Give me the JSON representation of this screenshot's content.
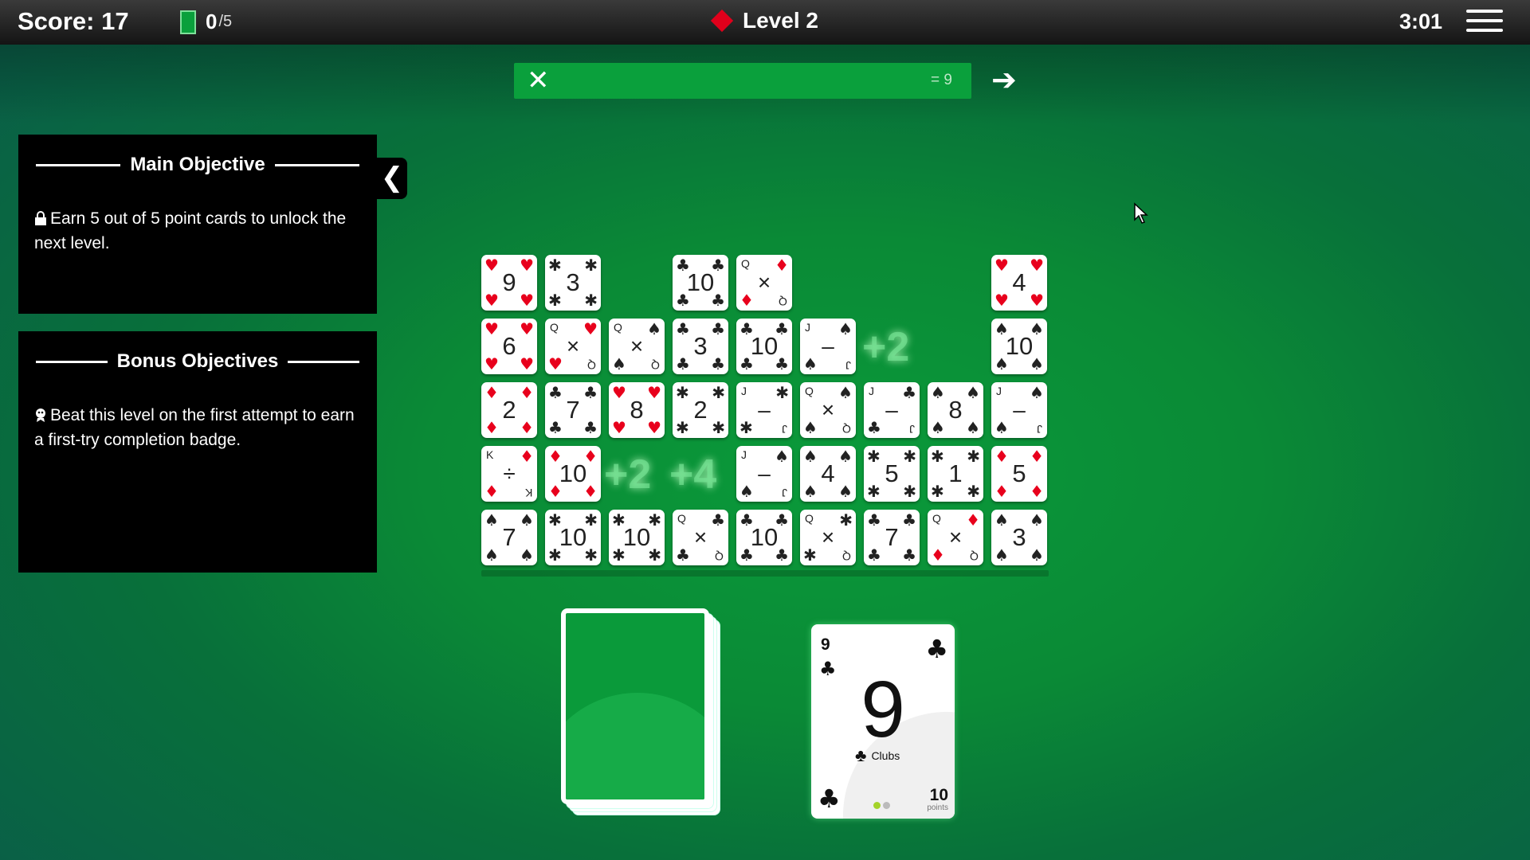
{
  "header": {
    "score_label": "Score: 17",
    "points_earned": "0",
    "points_total": "/5",
    "level_label": "Level 2",
    "timer": "3:01"
  },
  "equation": {
    "clear_symbol": "✕",
    "result": "= 9",
    "submit_symbol": "➔"
  },
  "main_objective": {
    "title": "Main Objective",
    "text": "Earn 5 out of 5 point cards to unlock the next level."
  },
  "bonus_objectives": {
    "title": "Bonus Objectives",
    "text": "Beat this level on the first attempt to earn a first-try completion badge."
  },
  "collapse_symbol": "❮",
  "colors": {
    "felt": "#0a9a3a",
    "accent_green": "#0aa03c",
    "red": "#e8001c"
  },
  "grid": [
    {
      "row": 0,
      "col": 0,
      "type": "number",
      "label": "9",
      "suit": "hearts"
    },
    {
      "row": 0,
      "col": 1,
      "type": "number",
      "label": "3",
      "suit": "bees"
    },
    {
      "row": 0,
      "col": 3,
      "type": "number",
      "label": "10",
      "suit": "clubs"
    },
    {
      "row": 0,
      "col": 4,
      "type": "operator",
      "face": "Q",
      "label": "×",
      "suit": "diamonds"
    },
    {
      "row": 0,
      "col": 8,
      "type": "number",
      "label": "4",
      "suit": "hearts"
    },
    {
      "row": 1,
      "col": 0,
      "type": "number",
      "label": "6",
      "suit": "hearts"
    },
    {
      "row": 1,
      "col": 1,
      "type": "operator",
      "face": "Q",
      "label": "×",
      "suit": "hearts"
    },
    {
      "row": 1,
      "col": 2,
      "type": "operator",
      "face": "Q",
      "label": "×",
      "suit": "spades"
    },
    {
      "row": 1,
      "col": 3,
      "type": "number",
      "label": "3",
      "suit": "clubs"
    },
    {
      "row": 1,
      "col": 4,
      "type": "number",
      "label": "10",
      "suit": "clubs"
    },
    {
      "row": 1,
      "col": 5,
      "type": "operator",
      "face": "J",
      "label": "–",
      "suit": "spades"
    },
    {
      "row": 1,
      "col": 8,
      "type": "number",
      "label": "10",
      "suit": "spades"
    },
    {
      "row": 2,
      "col": 0,
      "type": "number",
      "label": "2",
      "suit": "diamonds"
    },
    {
      "row": 2,
      "col": 1,
      "type": "number",
      "label": "7",
      "suit": "clubs"
    },
    {
      "row": 2,
      "col": 2,
      "type": "number",
      "label": "8",
      "suit": "hearts"
    },
    {
      "row": 2,
      "col": 3,
      "type": "number",
      "label": "2",
      "suit": "bees"
    },
    {
      "row": 2,
      "col": 4,
      "type": "operator",
      "face": "J",
      "label": "–",
      "suit": "bees"
    },
    {
      "row": 2,
      "col": 5,
      "type": "operator",
      "face": "Q",
      "label": "×",
      "suit": "spades"
    },
    {
      "row": 2,
      "col": 6,
      "type": "operator",
      "face": "J",
      "label": "–",
      "suit": "clubs"
    },
    {
      "row": 2,
      "col": 7,
      "type": "number",
      "label": "8",
      "suit": "spades"
    },
    {
      "row": 2,
      "col": 8,
      "type": "operator",
      "face": "J",
      "label": "–",
      "suit": "spades"
    },
    {
      "row": 3,
      "col": 0,
      "type": "operator",
      "face": "K",
      "label": "÷",
      "suit": "diamonds"
    },
    {
      "row": 3,
      "col": 1,
      "type": "number",
      "label": "10",
      "suit": "diamonds"
    },
    {
      "row": 3,
      "col": 4,
      "type": "operator",
      "face": "J",
      "label": "–",
      "suit": "spades"
    },
    {
      "row": 3,
      "col": 5,
      "type": "number",
      "label": "4",
      "suit": "spades"
    },
    {
      "row": 3,
      "col": 6,
      "type": "number",
      "label": "5",
      "suit": "bees"
    },
    {
      "row": 3,
      "col": 7,
      "type": "number",
      "label": "1",
      "suit": "bees"
    },
    {
      "row": 3,
      "col": 8,
      "type": "number",
      "label": "5",
      "suit": "diamonds"
    },
    {
      "row": 4,
      "col": 0,
      "type": "number",
      "label": "7",
      "suit": "spades"
    },
    {
      "row": 4,
      "col": 1,
      "type": "number",
      "label": "10",
      "suit": "bees"
    },
    {
      "row": 4,
      "col": 2,
      "type": "number",
      "label": "10",
      "suit": "bees"
    },
    {
      "row": 4,
      "col": 3,
      "type": "operator",
      "face": "Q",
      "label": "×",
      "suit": "clubs"
    },
    {
      "row": 4,
      "col": 4,
      "type": "number",
      "label": "10",
      "suit": "clubs"
    },
    {
      "row": 4,
      "col": 5,
      "type": "operator",
      "face": "Q",
      "label": "×",
      "suit": "bees"
    },
    {
      "row": 4,
      "col": 6,
      "type": "number",
      "label": "7",
      "suit": "clubs"
    },
    {
      "row": 4,
      "col": 7,
      "type": "operator",
      "face": "Q",
      "label": "×",
      "suit": "diamonds"
    },
    {
      "row": 4,
      "col": 8,
      "type": "number",
      "label": "3",
      "suit": "spades"
    }
  ],
  "bonus_pops": [
    {
      "label": "+2"
    },
    {
      "label": "+2"
    },
    {
      "label": "+4"
    }
  ],
  "drawn_card": {
    "rank": "9",
    "suit_name": "Clubs",
    "points": "10",
    "points_label": "points"
  }
}
